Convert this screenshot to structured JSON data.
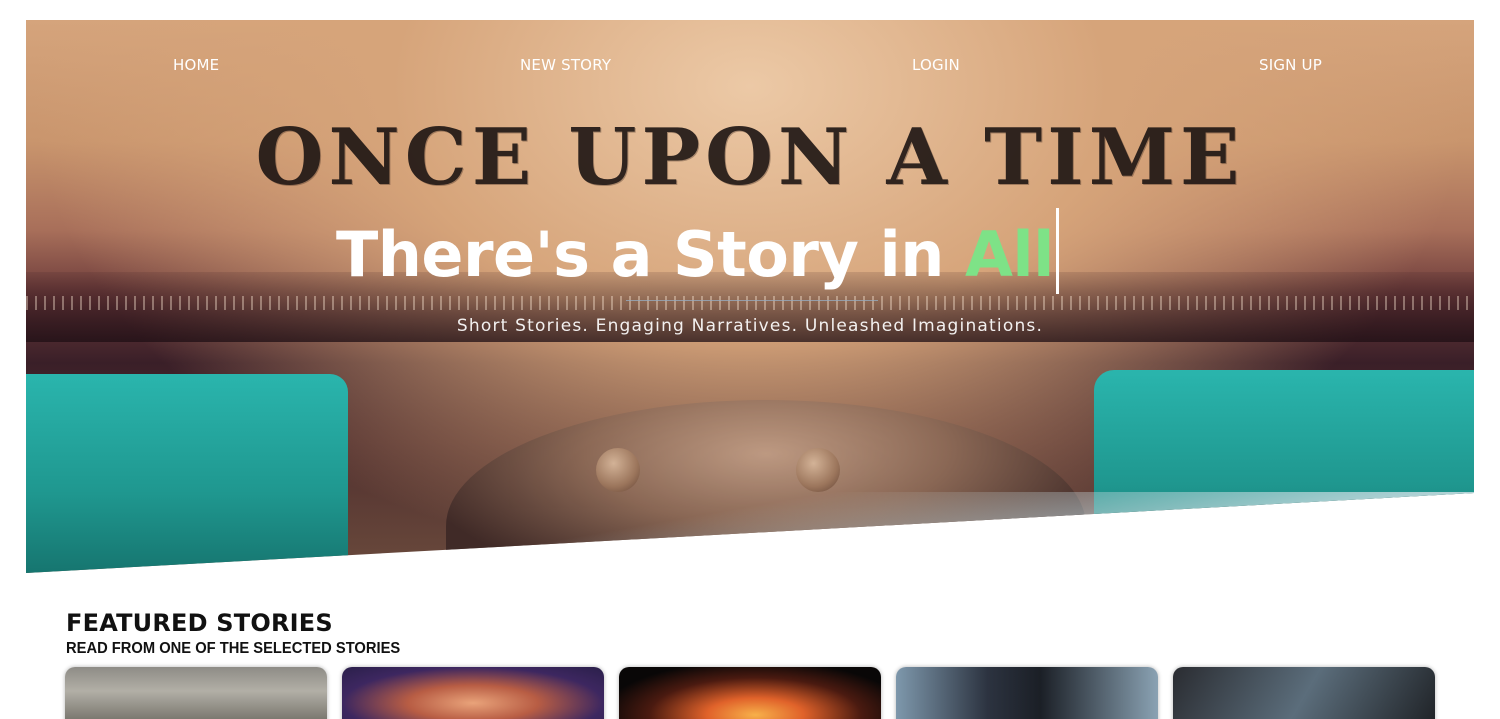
{
  "nav": {
    "home": "HOME",
    "new_story": "NEW STORY",
    "login": "LOGIN",
    "sign_up": "SIGN UP"
  },
  "hero": {
    "typed_text": "ONCE UPON A TIME",
    "headline_prefix": "There's a Story in ",
    "headline_accent": "All",
    "tagline": "Short Stories. Engaging Narratives. Unleashed Imaginations.",
    "accent_color": "#7ee287"
  },
  "featured": {
    "title": "FEATURED STORIES",
    "subtitle": "READ FROM ONE OF THE SELECTED STORIES",
    "cards": [
      {
        "image": "foggy-railway-image"
      },
      {
        "image": "astronaut-portrait-image"
      },
      {
        "image": "fire-flames-image"
      },
      {
        "image": "masked-figure-image"
      },
      {
        "image": "person-in-car-image"
      }
    ]
  }
}
